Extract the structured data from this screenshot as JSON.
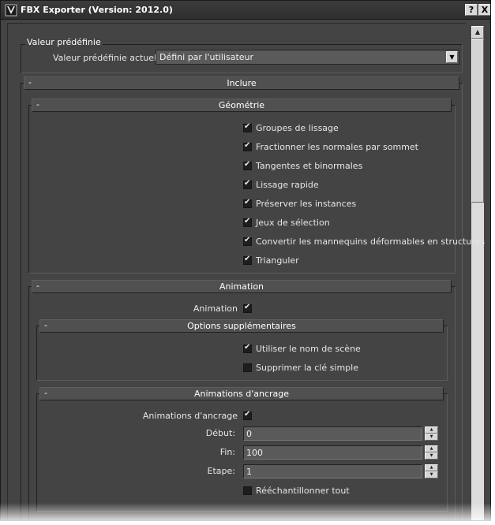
{
  "window": {
    "title": "FBX Exporter (Version: 2012.0)",
    "help_label": "?",
    "close_label": "X"
  },
  "preset": {
    "legend": "Valeur prédéfinie",
    "label": "Valeur prédéfinie actuelle:",
    "value": "Défini par l'utilisateur"
  },
  "include": {
    "toggle": "-",
    "title": "Inclure"
  },
  "geometry": {
    "toggle": "-",
    "title": "Géométrie",
    "options": [
      {
        "label": "Groupes de lissage",
        "checked": true
      },
      {
        "label": "Fractionner les normales par sommet",
        "checked": true
      },
      {
        "label": "Tangentes et binormales",
        "checked": true
      },
      {
        "label": "Lissage rapide",
        "checked": true
      },
      {
        "label": "Préserver les instances",
        "checked": true
      },
      {
        "label": "Jeux de sélection",
        "checked": true
      },
      {
        "label": "Convertir les mannequins déformables en structures",
        "checked": true
      },
      {
        "label": "Trianguler",
        "checked": true
      }
    ]
  },
  "animation": {
    "toggle": "-",
    "title": "Animation",
    "enable_label": "Animation",
    "enable_checked": true,
    "extra": {
      "toggle": "-",
      "title": "Options supplémentaires",
      "options": [
        {
          "label": "Utiliser le nom de scène",
          "checked": true
        },
        {
          "label": "Supprimer la clé simple",
          "checked": false
        }
      ]
    },
    "baked": {
      "toggle": "-",
      "title": "Animations d'ancrage",
      "enable_label": "Animations d'ancrage",
      "enable_checked": true,
      "start_label": "Début:",
      "start_value": "0",
      "end_label": "Fin:",
      "end_value": "100",
      "step_label": "Etape:",
      "step_value": "1",
      "resample_label": "Rééchantillonner tout",
      "resample_checked": false
    }
  },
  "icons": {
    "app": "fbx-app-icon",
    "dropdown": "chevron-down-icon",
    "spin_up": "triangle-up-icon",
    "spin_down": "triangle-down-icon"
  }
}
